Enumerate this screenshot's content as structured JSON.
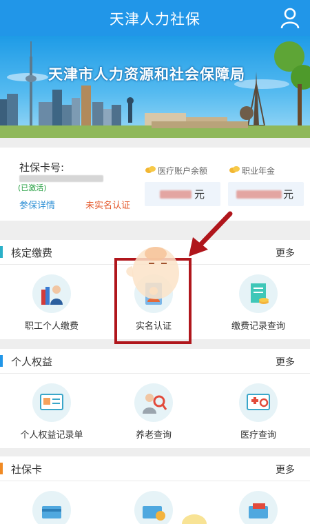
{
  "header": {
    "title": "天津人力社保",
    "user_icon": "user-icon"
  },
  "banner": {
    "slogan": "天津市人力资源和社会保障局"
  },
  "card": {
    "number_label": "社保卡号:",
    "status": "(已激活)",
    "detail_link": "参保详情",
    "verify_status": "未实名认证",
    "medical_balance_label": "医疗账户余额",
    "annuity_label": "职业年金",
    "currency_unit": "元"
  },
  "sections": {
    "contribution": {
      "title": "核定缴费",
      "more": "更多",
      "accent": "#2ab0c8",
      "items": [
        {
          "label": "职工个人缴费",
          "icon": "employee-icon"
        },
        {
          "label": "实名认证",
          "icon": "id-card-icon"
        },
        {
          "label": "缴费记录查询",
          "icon": "document-icon"
        }
      ]
    },
    "rights": {
      "title": "个人权益",
      "more": "更多",
      "accent": "#2196e8",
      "items": [
        {
          "label": "个人权益记录单",
          "icon": "record-icon"
        },
        {
          "label": "养老查询",
          "icon": "elderly-search-icon"
        },
        {
          "label": "医疗查询",
          "icon": "medical-icon"
        }
      ]
    },
    "card_service": {
      "title": "社保卡",
      "more": "更多",
      "accent": "#f08a24",
      "items": [
        {
          "icon": "card-icon"
        },
        {
          "icon": "card-reissue-icon"
        },
        {
          "icon": "card-lost-icon"
        }
      ]
    }
  },
  "colors": {
    "primary": "#2196e8",
    "highlight": "#b0161c",
    "warning": "#e4572a",
    "success": "#27a043"
  }
}
